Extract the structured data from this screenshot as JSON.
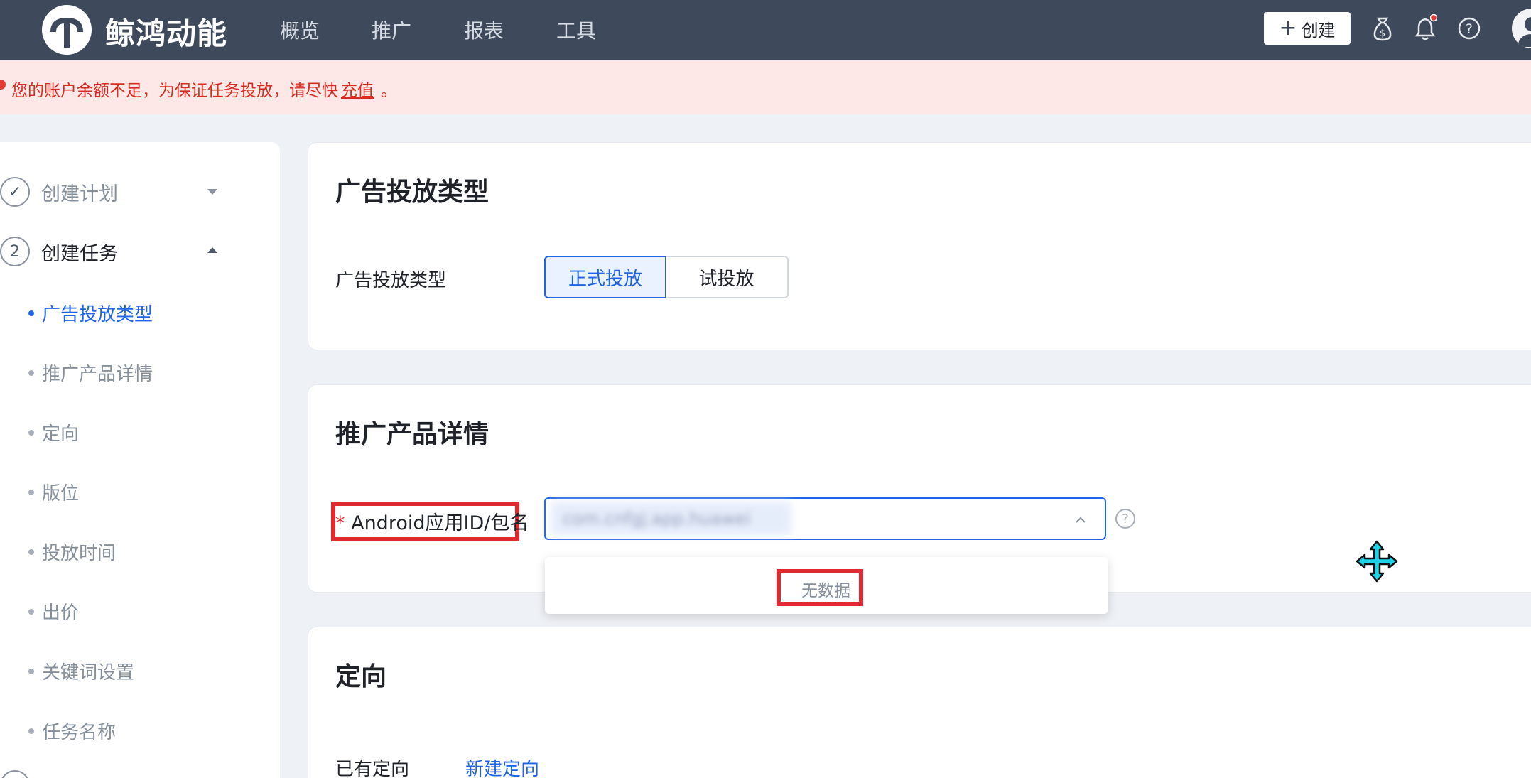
{
  "header": {
    "brand": "鲸鸿动能",
    "nav": [
      "概览",
      "推广",
      "报表",
      "工具"
    ],
    "create_label": "创建",
    "icons": [
      "money-bag-icon",
      "bell-icon",
      "help-icon",
      "user-avatar-icon"
    ],
    "notification_dot_color": "#e53935"
  },
  "alert": {
    "text": "您的账户余额不足，为保证任务投放，请尽快",
    "link": "充值",
    "tail": "。"
  },
  "sidebar": {
    "steps": [
      {
        "number": "✓",
        "label": "创建计划",
        "state": "done",
        "collapsed": true
      },
      {
        "number": "2",
        "label": "创建任务",
        "state": "current",
        "collapsed": false
      }
    ],
    "items": [
      {
        "label": "广告投放类型",
        "active": true
      },
      {
        "label": "推广产品详情",
        "active": false
      },
      {
        "label": "定向",
        "active": false
      },
      {
        "label": "版位",
        "active": false
      },
      {
        "label": "投放时间",
        "active": false
      },
      {
        "label": "出价",
        "active": false
      },
      {
        "label": "关键词设置",
        "active": false
      },
      {
        "label": "任务名称",
        "active": false
      }
    ]
  },
  "ad_type": {
    "title": "广告投放类型",
    "field_label": "广告投放类型",
    "options": [
      "正式投放",
      "试投放"
    ],
    "selected": "正式投放"
  },
  "product": {
    "title": "推广产品详情",
    "field_label": "Android应用ID/包名",
    "required_mark": "*",
    "select_value": "com.cnfgj.app.huawei",
    "dropdown_empty": "无数据"
  },
  "targeting": {
    "title": "定向",
    "existing_label": "已有定向",
    "new_link": "新建定向"
  },
  "colors": {
    "topbar": "#3e4a5c",
    "accent": "#1f63e6",
    "alert_bg": "#fde8e7",
    "alert_text": "#d82c20",
    "highlight": "#e02a2f"
  }
}
